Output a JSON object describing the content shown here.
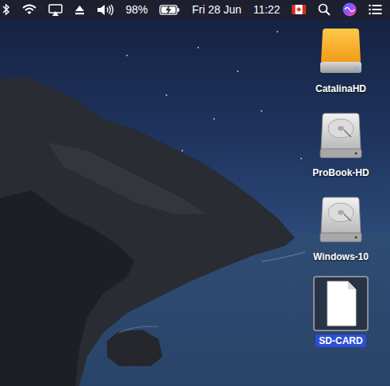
{
  "menu_bar": {
    "battery": {
      "percent": "98%",
      "level": 0.98,
      "charging": true
    },
    "date": "Fri 28 Jun",
    "time": "11:22"
  },
  "desktop": {
    "icons": [
      {
        "label": "CatalinaHD",
        "kind": "external-drive",
        "selected": false
      },
      {
        "label": "ProBook-HD",
        "kind": "internal-drive",
        "selected": false
      },
      {
        "label": "Windows-10",
        "kind": "internal-drive",
        "selected": false
      },
      {
        "label": "SD-CARD",
        "kind": "document",
        "selected": true
      }
    ]
  }
}
